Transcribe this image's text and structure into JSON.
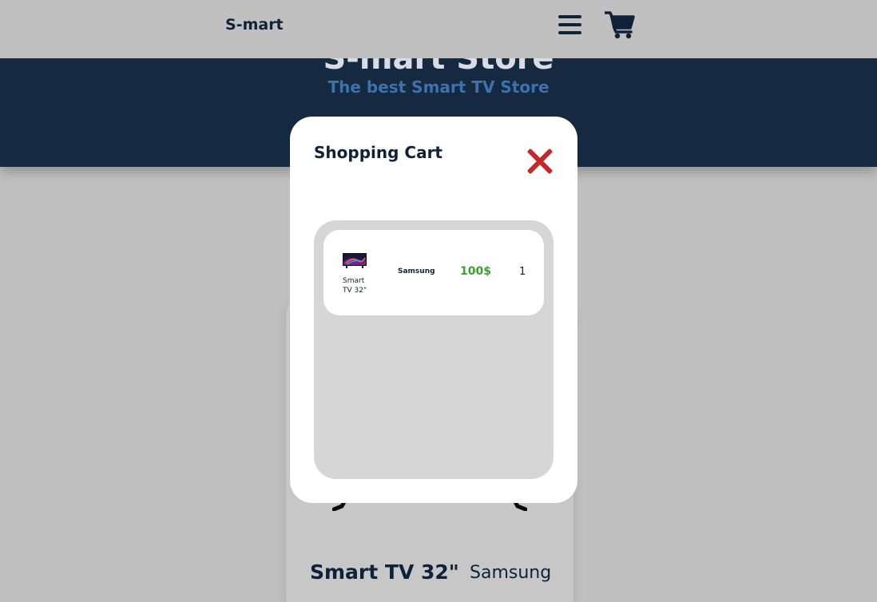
{
  "navbar": {
    "brand": "S-mart",
    "icons": {
      "menu": "menu-icon",
      "cart": "cart-icon"
    }
  },
  "hero": {
    "title": "S-mart Store",
    "subtitle": "The best Smart TV Store"
  },
  "product_card": {
    "name": "Smart TV 32\"",
    "brand": "Samsung"
  },
  "cart_modal": {
    "title": "Shopping Cart",
    "close_icon": "close-icon",
    "items": [
      {
        "name": "Smart TV 32\"",
        "brand": "Samsung",
        "price": "100$",
        "quantity": "1"
      }
    ]
  },
  "colors": {
    "navy": "#0f2238",
    "hero_bg": "#152941",
    "accent_blue": "#3c72ad",
    "price_green": "#3aa02f",
    "close_red": "#c62828",
    "page_bg": "#c0c0c0"
  }
}
